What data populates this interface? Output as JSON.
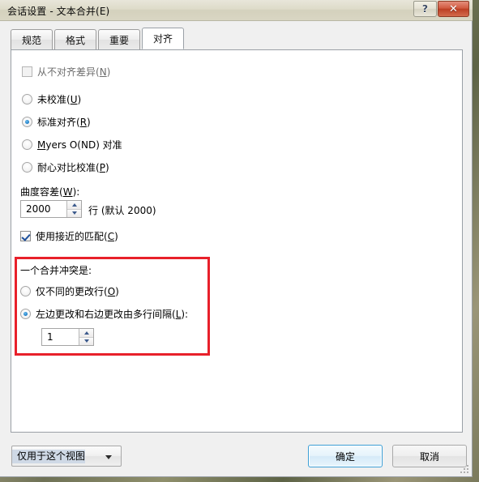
{
  "window": {
    "title": "会话设置 - 文本合并(E)",
    "help_button": "?",
    "close_button": "✕"
  },
  "tabs": [
    {
      "label": "规范",
      "active": false
    },
    {
      "label": "格式",
      "active": false
    },
    {
      "label": "重要",
      "active": false
    },
    {
      "label": "对齐",
      "active": true
    }
  ],
  "panel": {
    "never_align_checkbox": {
      "label_prefix": "从不对齐差异(",
      "accel": "N",
      "label_suffix": ")",
      "checked": false,
      "enabled": false
    },
    "align_options": [
      {
        "label_prefix": "未校准(",
        "accel": "U",
        "label_suffix": ")",
        "selected": false
      },
      {
        "label_prefix": "标准对齐(",
        "accel": "R",
        "label_suffix": ")",
        "selected": true
      },
      {
        "label_prefix": "",
        "accel": "M",
        "label_mid": "yers O(ND) 对准",
        "label_suffix": "",
        "selected": false
      },
      {
        "label_prefix": "耐心对比校准(",
        "accel": "P",
        "label_suffix": ")",
        "selected": false
      }
    ],
    "curvature_label": {
      "text_prefix": "曲度容差(",
      "accel": "W",
      "text_suffix": "):"
    },
    "curvature_spinner": {
      "value": "2000",
      "unit_text": "行 (默认 2000)"
    },
    "near_match_checkbox": {
      "label_prefix": "使用接近的匹配(",
      "accel": "C",
      "label_suffix": ")",
      "checked": true
    },
    "conflict_group": {
      "title": "一个合并冲突是:",
      "options": [
        {
          "label_prefix": "仅不同的更改行(",
          "accel": "O",
          "label_suffix": ")",
          "selected": false
        },
        {
          "label_prefix": "左边更改和右边更改由多行间隔(",
          "accel": "L",
          "label_suffix": "):",
          "selected": true
        }
      ],
      "spinner_value": "1",
      "highlight_color": "#e8202a"
    }
  },
  "footer": {
    "scope_combo": {
      "value": "仅用于这个视图"
    },
    "ok_button": "确定",
    "cancel_button": "取消"
  }
}
